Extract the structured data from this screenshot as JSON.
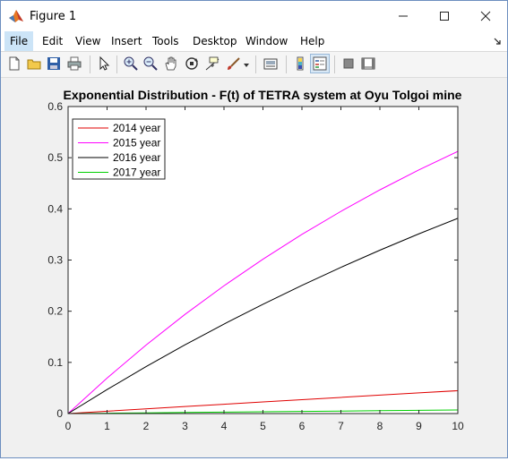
{
  "window": {
    "title": "Figure 1",
    "icon": "matlab-icon",
    "controls": [
      "minimize-icon",
      "maximize-icon",
      "close-icon"
    ]
  },
  "menu": {
    "items": [
      "File",
      "Edit",
      "View",
      "Insert",
      "Tools",
      "Desktop",
      "Window",
      "Help"
    ],
    "active": "File"
  },
  "toolbar": {
    "icons": [
      "new-figure-icon",
      "open-file-icon",
      "save-icon",
      "print-icon",
      "pointer-icon",
      "zoom-in-icon",
      "zoom-out-icon",
      "pan-icon",
      "rotate-3d-icon",
      "data-cursor-icon",
      "brush-icon",
      "link-plot-icon",
      "colorbar-icon",
      "legend-icon",
      "hide-plot-tools-icon",
      "show-plot-tools-icon"
    ]
  },
  "colors": {
    "series_2014": "#e00000",
    "series_2015": "#ff00ff",
    "series_2016": "#000000",
    "series_2017": "#00d000",
    "figure_bg": "#f0f0f0",
    "axes_bg": "#ffffff"
  },
  "chart_data": {
    "type": "line",
    "title": "Exponential Distribution - F(t) of TETRA system at Oyu Tolgoi mine",
    "xlabel": "",
    "ylabel": "",
    "xlim": [
      0,
      10
    ],
    "ylim": [
      0,
      0.6
    ],
    "xticks": [
      "0",
      "1",
      "2",
      "3",
      "4",
      "5",
      "6",
      "7",
      "8",
      "9",
      "10"
    ],
    "yticks": [
      "0",
      "0.1",
      "0.2",
      "0.3",
      "0.4",
      "0.5",
      "0.6"
    ],
    "legend_position": "top-left",
    "grid": false,
    "x": [
      0,
      1,
      2,
      3,
      4,
      5,
      6,
      7,
      8,
      9,
      10
    ],
    "series": [
      {
        "name": "2014 year",
        "color": "#e00000",
        "values": [
          0,
          0.0046,
          0.0092,
          0.0137,
          0.0182,
          0.0227,
          0.0272,
          0.0316,
          0.036,
          0.0404,
          0.0447
        ]
      },
      {
        "name": "2015 year",
        "color": "#ff00ff",
        "values": [
          0,
          0.0693,
          0.1338,
          0.1938,
          0.2497,
          0.3017,
          0.3501,
          0.3951,
          0.4371,
          0.4761,
          0.5124
        ]
      },
      {
        "name": "2016 year",
        "color": "#000000",
        "values": [
          0,
          0.0469,
          0.0917,
          0.1343,
          0.1749,
          0.2136,
          0.2505,
          0.2857,
          0.3192,
          0.3512,
          0.3816
        ]
      },
      {
        "name": "2017 year",
        "color": "#00d000",
        "values": [
          0,
          0.0007,
          0.0014,
          0.0021,
          0.0028,
          0.0035,
          0.0042,
          0.0049,
          0.0056,
          0.0063,
          0.007
        ]
      }
    ]
  }
}
